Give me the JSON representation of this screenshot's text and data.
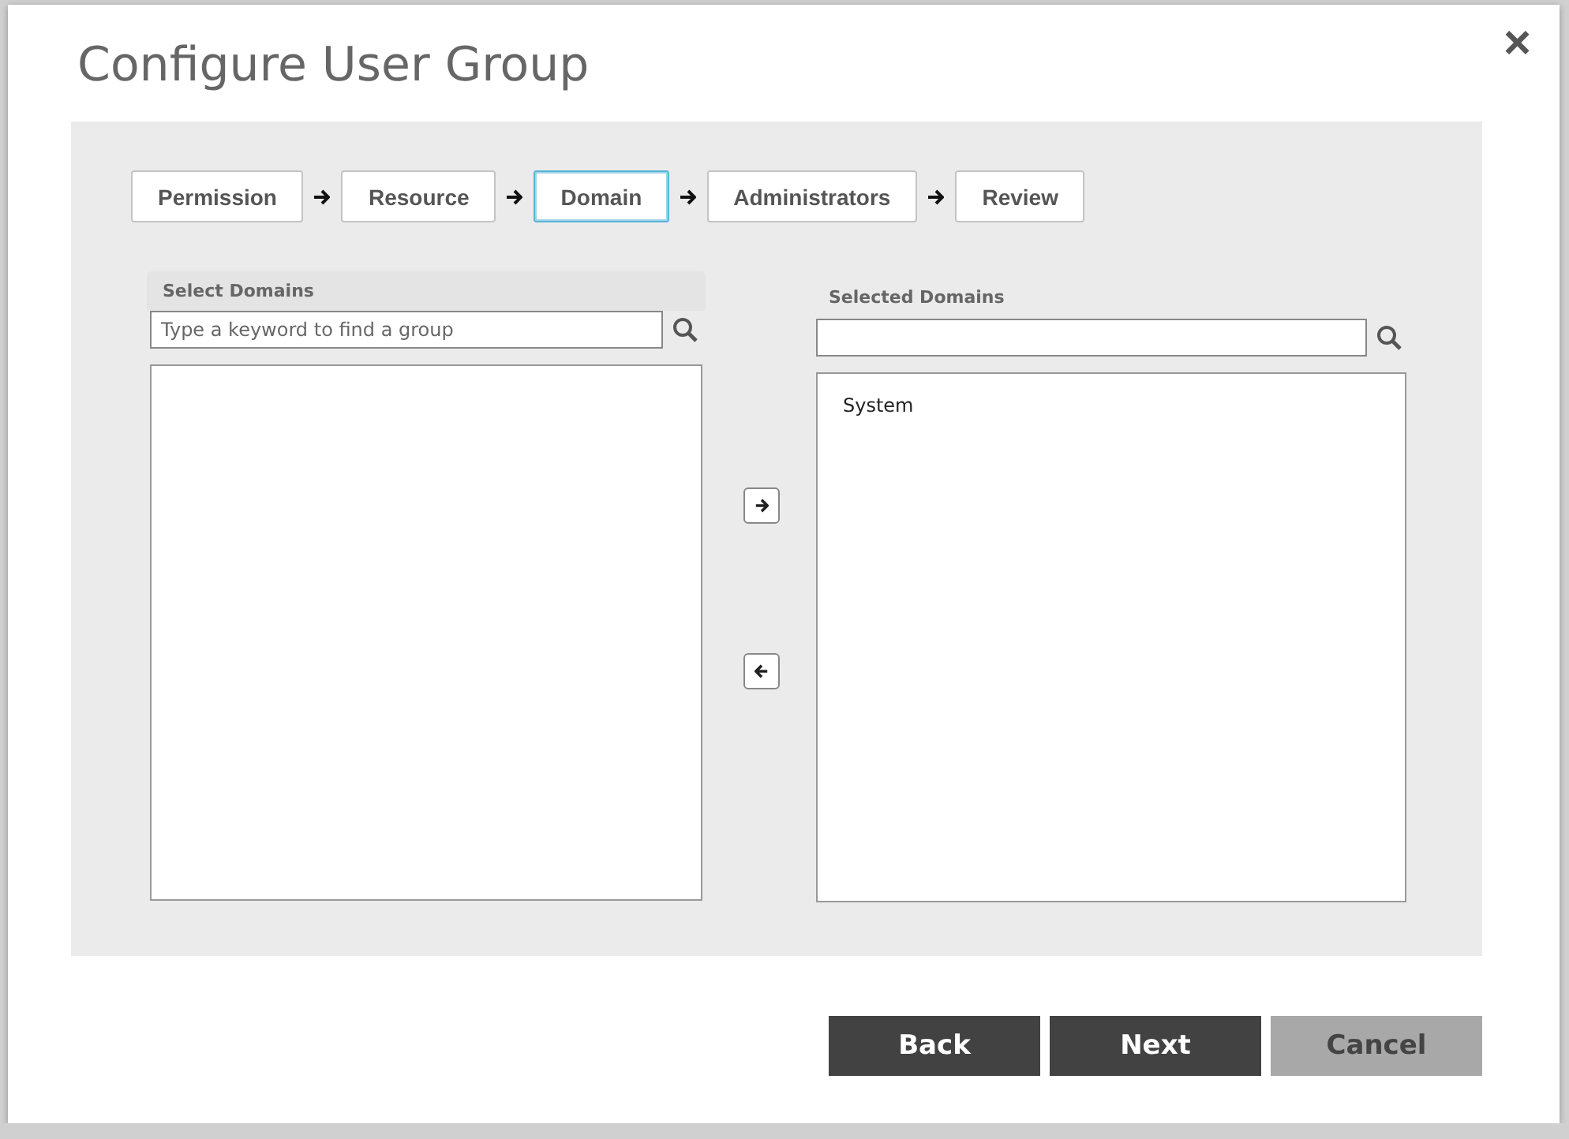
{
  "dialog": {
    "title": "Configure User Group",
    "close": "×"
  },
  "steps": [
    {
      "label": "Permission",
      "selected": false
    },
    {
      "label": "Resource",
      "selected": false
    },
    {
      "label": "Domain",
      "selected": true
    },
    {
      "label": "Administrators",
      "selected": false
    },
    {
      "label": "Review",
      "selected": false
    }
  ],
  "available": {
    "label": "Select Domains",
    "search": {
      "placeholder": "Type a keyword to find a group"
    }
  },
  "selected": {
    "label": "Selected Domains",
    "items": [
      "System"
    ]
  },
  "footer_buttons": [
    {
      "label": "Back",
      "kind": "dark"
    },
    {
      "label": "Next",
      "kind": "dark"
    },
    {
      "label": "Cancel",
      "kind": "muted"
    }
  ]
}
